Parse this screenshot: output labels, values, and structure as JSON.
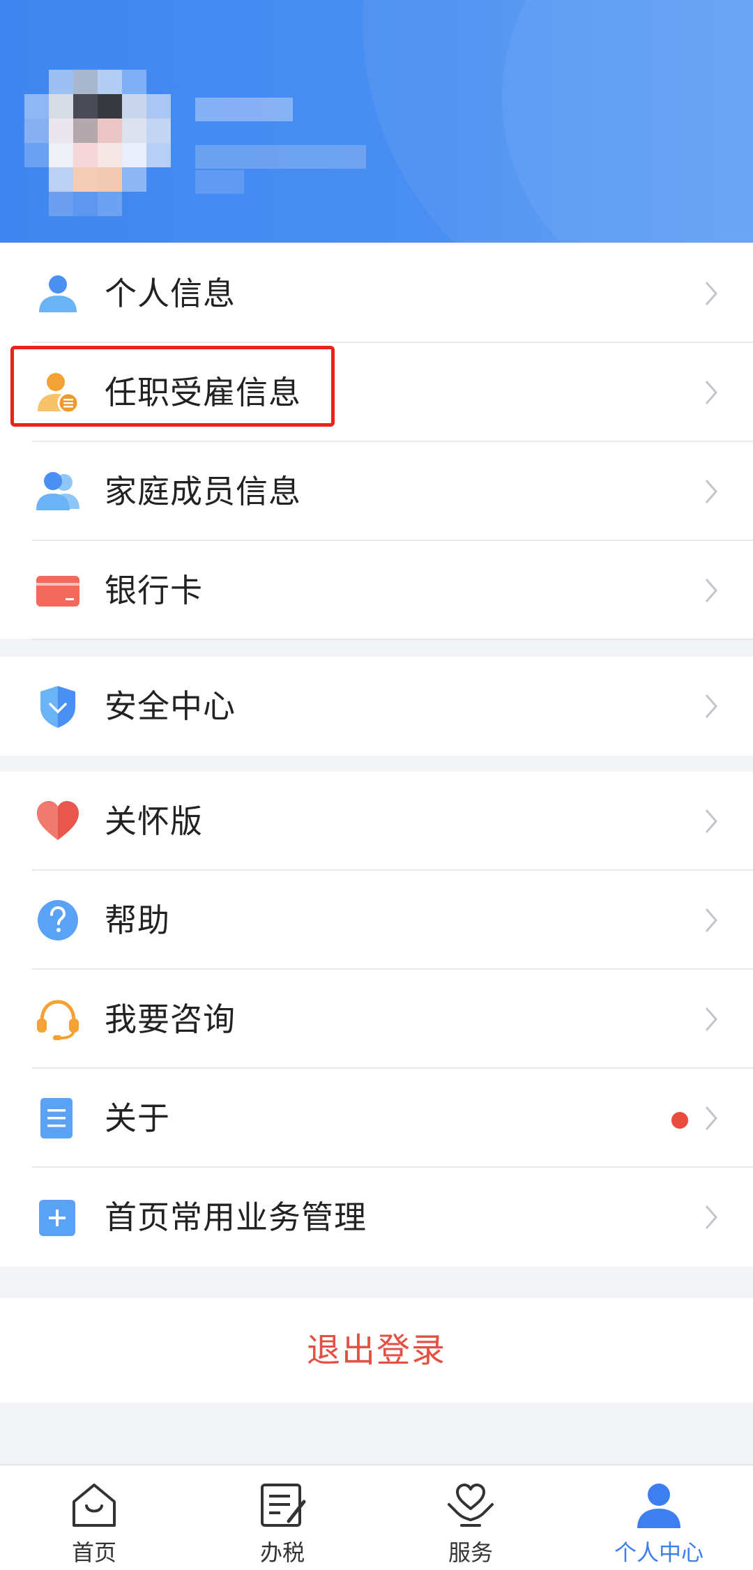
{
  "menu_groups": [
    {
      "items": [
        {
          "label": "个人信息",
          "icon": "person-icon"
        },
        {
          "label": "任职受雇信息",
          "icon": "employment-icon"
        },
        {
          "label": "家庭成员信息",
          "icon": "family-icon"
        },
        {
          "label": "银行卡",
          "icon": "bank-card-icon"
        }
      ]
    },
    {
      "items": [
        {
          "label": "安全中心",
          "icon": "shield-icon"
        }
      ]
    },
    {
      "items": [
        {
          "label": "关怀版",
          "icon": "heart-icon"
        },
        {
          "label": "帮助",
          "icon": "help-icon"
        },
        {
          "label": "我要咨询",
          "icon": "headset-icon"
        },
        {
          "label": "关于",
          "icon": "document-icon"
        },
        {
          "label": "首页常用业务管理",
          "icon": "plus-icon"
        }
      ]
    }
  ],
  "logout_label": "退出登录",
  "tabs": [
    {
      "label": "首页",
      "icon": "home-icon"
    },
    {
      "label": "办税",
      "icon": "tax-icon"
    },
    {
      "label": "服务",
      "icon": "service-icon"
    },
    {
      "label": "个人中心",
      "icon": "profile-icon",
      "active": true
    }
  ],
  "colors": {
    "header_blue": "#3f86f0",
    "accent": "#3d7ff0",
    "logout_red": "#e35144",
    "highlight_red": "#e8231a"
  }
}
